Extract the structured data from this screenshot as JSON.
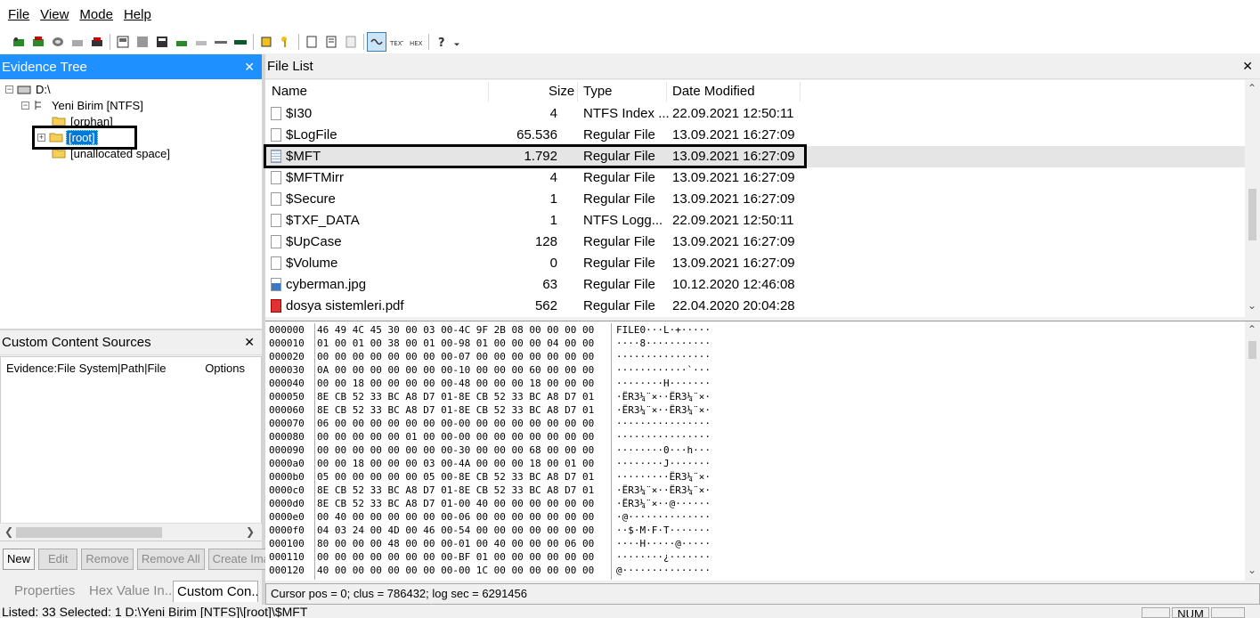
{
  "menu": [
    "File",
    "View",
    "Mode",
    "Help"
  ],
  "toolbar_icons": [
    "add-evidence-icon",
    "add-all-evidence-icon",
    "image-file-icon",
    "remove-evidence-icon",
    "remove-all-icon",
    "create-disk-image-icon",
    "save-icon",
    "export-icon",
    "verify-drive-icon",
    "capture-memory-icon",
    "obtain-protected-files-icon",
    "detect-encryption-icon",
    "decrypt-icon",
    "export-files-icon",
    "view-files-icon",
    "export-directory-listing-icon",
    "natural-view-icon",
    "text-view-icon",
    "hex-view-icon",
    "help-icon",
    "dropdown-icon"
  ],
  "evidence_tree": {
    "title": "Evidence Tree",
    "nodes": [
      {
        "label": "D:\\"
      },
      {
        "label": "Yeni Birim [NTFS]"
      },
      {
        "label": "[orphan]"
      },
      {
        "label": "[root]",
        "selected": true
      },
      {
        "label": "[unallocated space]"
      }
    ]
  },
  "custom_content": {
    "title": "Custom Content Sources",
    "col1": "Evidence:File System|Path|File",
    "col2": "Options",
    "buttons": [
      "New",
      "Edit",
      "Remove",
      "Remove All",
      "Create Image"
    ]
  },
  "bottom_tabs": [
    "Properties",
    "Hex Value In...",
    "Custom Con..."
  ],
  "file_list": {
    "title": "File List",
    "columns": [
      "Name",
      "Size",
      "Type",
      "Date Modified"
    ],
    "rows": [
      {
        "name": "$I30",
        "size": "4",
        "type": "NTFS Index ...",
        "date": "22.09.2021 12:50:11",
        "icon": "file"
      },
      {
        "name": "$LogFile",
        "size": "65.536",
        "type": "Regular File",
        "date": "13.09.2021 16:27:09",
        "icon": "file"
      },
      {
        "name": "$MFT",
        "size": "1.792",
        "type": "Regular File",
        "date": "13.09.2021 16:27:09",
        "icon": "table",
        "selected": true
      },
      {
        "name": "$MFTMirr",
        "size": "4",
        "type": "Regular File",
        "date": "13.09.2021 16:27:09",
        "icon": "file"
      },
      {
        "name": "$Secure",
        "size": "1",
        "type": "Regular File",
        "date": "13.09.2021 16:27:09",
        "icon": "file"
      },
      {
        "name": "$TXF_DATA",
        "size": "1",
        "type": "NTFS Logg...",
        "date": "22.09.2021 12:50:11",
        "icon": "file"
      },
      {
        "name": "$UpCase",
        "size": "128",
        "type": "Regular File",
        "date": "13.09.2021 16:27:09",
        "icon": "file"
      },
      {
        "name": "$Volume",
        "size": "0",
        "type": "Regular File",
        "date": "13.09.2021 16:27:09",
        "icon": "file"
      },
      {
        "name": "cyberman.jpg",
        "size": "63",
        "type": "Regular File",
        "date": "10.12.2020 12:46:08",
        "icon": "image"
      },
      {
        "name": "dosya sistemleri.pdf",
        "size": "562",
        "type": "Regular File",
        "date": "22.04.2020 20:04:28",
        "icon": "pdf"
      }
    ]
  },
  "hex_view": {
    "lines": [
      {
        "off": "000000",
        "bytes": "46 49 4C 45 30 00 03 00-4C 9F 2B 08 00 00 00 00",
        "ascii": "FILE0···L·+·····"
      },
      {
        "off": "000010",
        "bytes": "01 00 01 00 38 00 01 00-98 01 00 00 00 04 00 00",
        "ascii": "····8···········"
      },
      {
        "off": "000020",
        "bytes": "00 00 00 00 00 00 00 00-07 00 00 00 00 00 00 00",
        "ascii": "················"
      },
      {
        "off": "000030",
        "bytes": "0A 00 00 00 00 00 00 00-10 00 00 00 60 00 00 00",
        "ascii": "············`···"
      },
      {
        "off": "000040",
        "bytes": "00 00 18 00 00 00 00 00-48 00 00 00 18 00 00 00",
        "ascii": "········H·······"
      },
      {
        "off": "000050",
        "bytes": "8E CB 52 33 BC A8 D7 01-8E CB 52 33 BC A8 D7 01",
        "ascii": "·ËR3¼¨×··ËR3¼¨×·"
      },
      {
        "off": "000060",
        "bytes": "8E CB 52 33 BC A8 D7 01-8E CB 52 33 BC A8 D7 01",
        "ascii": "·ËR3¼¨×··ËR3¼¨×·"
      },
      {
        "off": "000070",
        "bytes": "06 00 00 00 00 00 00 00-00 00 00 00 00 00 00 00",
        "ascii": "················"
      },
      {
        "off": "000080",
        "bytes": "00 00 00 00 00 01 00 00-00 00 00 00 00 00 00 00",
        "ascii": "················"
      },
      {
        "off": "000090",
        "bytes": "00 00 00 00 00 00 00 00-30 00 00 00 68 00 00 00",
        "ascii": "········0···h···"
      },
      {
        "off": "0000a0",
        "bytes": "00 00 18 00 00 00 03 00-4A 00 00 00 18 00 01 00",
        "ascii": "········J·······"
      },
      {
        "off": "0000b0",
        "bytes": "05 00 00 00 00 00 05 00-8E CB 52 33 BC A8 D7 01",
        "ascii": "·········ËR3¼¨×·"
      },
      {
        "off": "0000c0",
        "bytes": "8E CB 52 33 BC A8 D7 01-8E CB 52 33 BC A8 D7 01",
        "ascii": "·ËR3¼¨×··ËR3¼¨×·"
      },
      {
        "off": "0000d0",
        "bytes": "8E CB 52 33 BC A8 D7 01-00 40 00 00 00 00 00 00",
        "ascii": "·ËR3¼¨×··@······"
      },
      {
        "off": "0000e0",
        "bytes": "00 40 00 00 00 00 00 00-06 00 00 00 00 00 00 00",
        "ascii": "·@··············"
      },
      {
        "off": "0000f0",
        "bytes": "04 03 24 00 4D 00 46 00-54 00 00 00 00 00 00 00",
        "ascii": "··$·M·F·T·······"
      },
      {
        "off": "000100",
        "bytes": "80 00 00 00 48 00 00 00-01 00 40 00 00 00 06 00",
        "ascii": "····H·····@·····"
      },
      {
        "off": "000110",
        "bytes": "00 00 00 00 00 00 00 00-BF 01 00 00 00 00 00 00",
        "ascii": "········¿·······"
      },
      {
        "off": "000120",
        "bytes": "40 00 00 00 00 00 00 00-00 1C 00 00 00 00 00 00",
        "ascii": "@···············"
      }
    ]
  },
  "cursor_status": "Cursor pos = 0; clus = 786432; log sec = 6291456",
  "status_bar": "Listed: 33   Selected: 1   D:\\Yeni Birim [NTFS]\\[root]\\$MFT",
  "status_num": "NUM",
  "colors": {
    "title_blue": "#1e90ff",
    "selection": "#0078d7"
  }
}
